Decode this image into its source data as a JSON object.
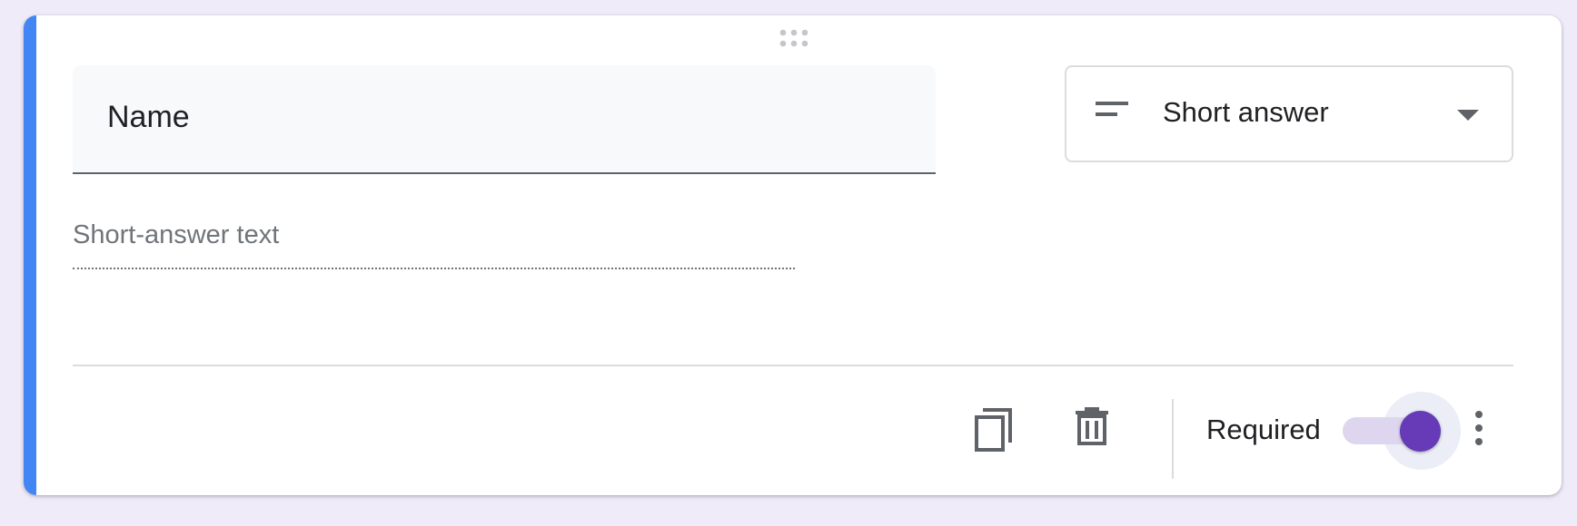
{
  "question": {
    "title": "Name",
    "answer_placeholder": "Short-answer text"
  },
  "type_selector": {
    "selected": "Short answer",
    "icon": "short-text-icon"
  },
  "footer": {
    "copy_icon": "copy-icon",
    "delete_icon": "trash-icon",
    "required_label": "Required",
    "required_on": true,
    "more_icon": "more-vert-icon"
  },
  "colors": {
    "accent": "#4285f4",
    "toggle_on": "#673ab7",
    "background": "#efebf8"
  }
}
